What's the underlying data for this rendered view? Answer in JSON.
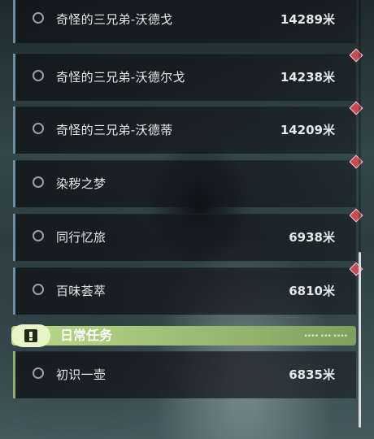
{
  "quests": [
    {
      "name": "奇怪的三兄弟-沃德戈",
      "distance": "14289米"
    },
    {
      "name": "奇怪的三兄弟-沃德尔戈",
      "distance": "14238米"
    },
    {
      "name": "奇怪的三兄弟-沃德蒂",
      "distance": "14209米"
    },
    {
      "name": "染秽之梦",
      "distance": ""
    },
    {
      "name": "同行忆旅",
      "distance": "6938米"
    },
    {
      "name": "百味荟萃",
      "distance": "6810米"
    }
  ],
  "daily": {
    "title": "日常任务",
    "items": [
      {
        "name": "初识一壶",
        "distance": "6835米"
      }
    ]
  },
  "colors": {
    "accent_blue": "#6d8fa4",
    "daily_green": "#9fc176",
    "marker_red": "#c94a55"
  },
  "icons": {
    "untracked": "circle-icon",
    "tracked_marker": "diamond-marker-icon",
    "daily": "exclamation-icon"
  }
}
